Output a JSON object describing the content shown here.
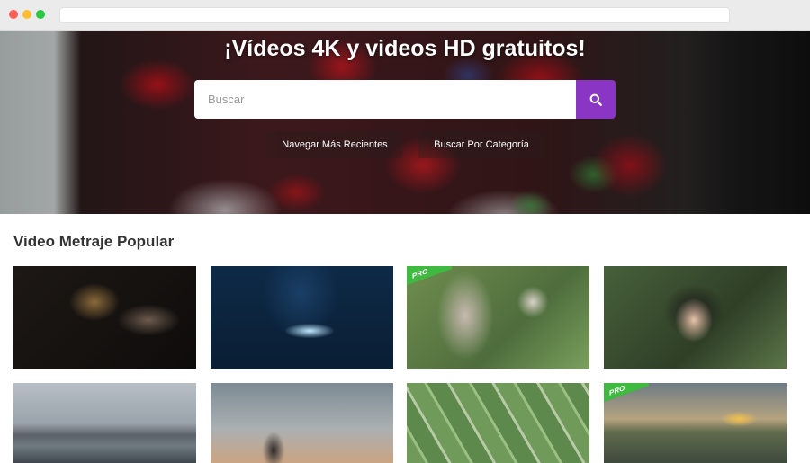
{
  "hero": {
    "title": "¡Vídeos 4K y videos HD gratuitos!",
    "search_placeholder": "Buscar",
    "search_icon": "search-icon",
    "accent_color": "#8a35c4",
    "buttons": [
      {
        "label": "Navegar Más Recientes"
      },
      {
        "label": "Buscar Por Categoría"
      }
    ]
  },
  "popular": {
    "title": "Video Metraje Popular",
    "badge_label": "PRO",
    "badge_color": "#3fb93f",
    "videos": [
      {
        "subject": "vinyl-record",
        "pro": false
      },
      {
        "subject": "hands-tablet",
        "pro": false
      },
      {
        "subject": "elderly-woman-garden",
        "pro": true
      },
      {
        "subject": "child-headphones",
        "pro": false
      },
      {
        "subject": "coastal-city",
        "pro": false
      },
      {
        "subject": "person-drone",
        "pro": false
      },
      {
        "subject": "aerial-fields",
        "pro": false
      },
      {
        "subject": "city-sunset",
        "pro": true
      }
    ]
  }
}
